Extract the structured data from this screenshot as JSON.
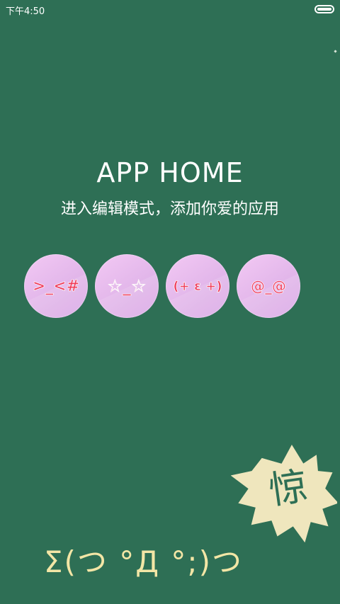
{
  "status_bar": {
    "time": "下午4:50"
  },
  "header": {
    "title": "APP HOME",
    "subtitle": "进入编辑模式，添加你爱的应用"
  },
  "app_slots": [
    {
      "face": ">_<#"
    },
    {
      "face": "☆_☆"
    },
    {
      "face": "(+ ε +)"
    },
    {
      "face": "@_@"
    }
  ],
  "decoration": {
    "burst_text": "惊",
    "kaomoji": "Σ(つ °Д °;)つ"
  },
  "colors": {
    "background": "#2e6f55",
    "slot_fill": "#e6b8ee",
    "face_text": "#ef3b5a",
    "burst_fill": "#efe6bd",
    "kaomoji_text": "#f3e6a6"
  }
}
